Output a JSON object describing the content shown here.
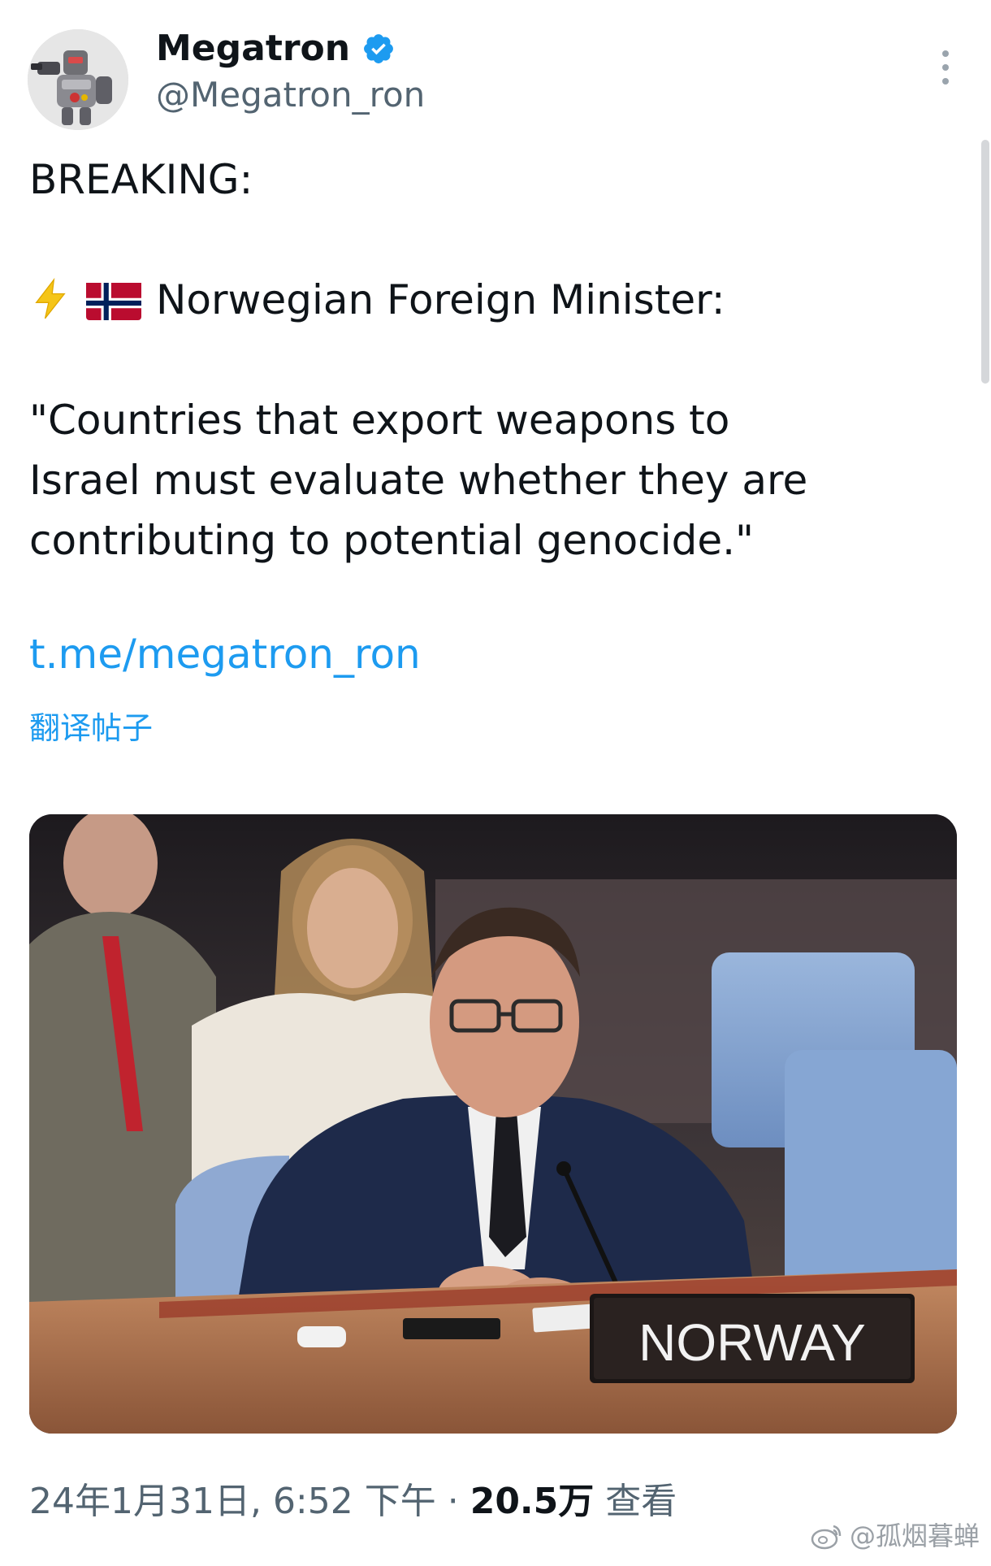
{
  "author": {
    "display_name": "Megatron",
    "handle": "@Megatron_ron",
    "avatar_icon": "robot-avatar",
    "verified_icon": "verified-badge-icon",
    "verified_color": "#1d9bf0"
  },
  "more_icon": "more-vertical-icon",
  "tweet": {
    "line_breaking": "BREAKING:",
    "minister_line": "Norwegian Foreign Minister:",
    "quote_line1": "\"Countries that export weapons to",
    "quote_line2": "Israel must evaluate whether they are",
    "quote_line3": "contributing to potential genocide.\"",
    "link": "t.me/megatron_ron",
    "translate_label": "翻译帖子",
    "emoji_icons": [
      "lightning-bolt-icon",
      "norway-flag-icon"
    ]
  },
  "media": {
    "nameplate_text": "NORWAY"
  },
  "meta": {
    "date_time": "24年1月31日, 6:52 下午 · ",
    "views_count": "20.5万",
    "views_label": " 查看"
  },
  "watermark": {
    "text": "@孤烟暮蝉",
    "icon": "weibo-icon"
  },
  "colors": {
    "link": "#1d9bf0",
    "secondary_text": "#536471",
    "primary_text": "#0f1419"
  }
}
